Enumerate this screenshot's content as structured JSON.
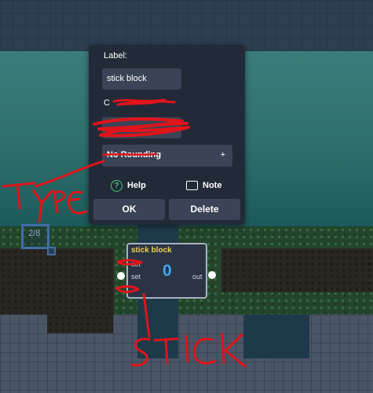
{
  "dialog": {
    "label_heading": "Label:",
    "label_value": "stick block",
    "channel_heading": "C",
    "channel_value": "",
    "rounding_value": "No Rounding",
    "rounding_plus": "+",
    "help_label": "Help",
    "note_label": "Note",
    "ok_label": "OK",
    "delete_label": "Delete"
  },
  "zone": {
    "counter": "2/8"
  },
  "node": {
    "title": "stick block",
    "value": "0",
    "in1": "set",
    "in2": "set",
    "out": "out"
  },
  "annotations": {
    "type_text": "TYPE",
    "stick_text": "STICK"
  },
  "colors": {
    "dialog_bg": "#222a38",
    "field_bg": "#3b4456",
    "node_title": "#f2cf4a",
    "node_value": "#3ea7f0",
    "help_green": "#49c47a",
    "scribble_red": "#e0141a"
  }
}
